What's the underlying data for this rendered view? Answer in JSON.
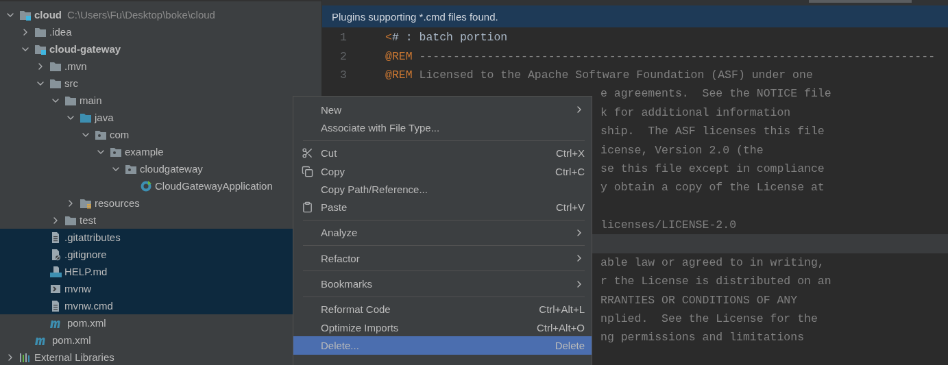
{
  "project_tree": {
    "items": [
      {
        "kind": "module",
        "name": "cloud",
        "path": "C:\\Users\\Fu\\Desktop\\boke\\cloud",
        "expanded": true,
        "selected": false,
        "children": [
          {
            "kind": "folder",
            "name": ".idea",
            "expanded": false,
            "selected": false
          },
          {
            "kind": "module",
            "name": "cloud-gateway",
            "expanded": true,
            "selected": false,
            "children": [
              {
                "kind": "folder",
                "name": ".mvn",
                "expanded": false,
                "selected": false
              },
              {
                "kind": "folder",
                "name": "src",
                "expanded": true,
                "selected": false,
                "children": [
                  {
                    "kind": "folder",
                    "name": "main",
                    "expanded": true,
                    "selected": false,
                    "children": [
                      {
                        "kind": "source",
                        "name": "java",
                        "expanded": true,
                        "selected": false,
                        "children": [
                          {
                            "kind": "package",
                            "name": "com",
                            "expanded": true,
                            "selected": false,
                            "children": [
                              {
                                "kind": "package",
                                "name": "example",
                                "expanded": true,
                                "selected": false,
                                "children": [
                                  {
                                    "kind": "package",
                                    "name": "cloudgateway",
                                    "expanded": true,
                                    "selected": false,
                                    "children": [
                                      {
                                        "kind": "class",
                                        "name": "CloudGatewayApplication",
                                        "selected": false
                                      }
                                    ]
                                  }
                                ]
                              }
                            ]
                          }
                        ]
                      },
                      {
                        "kind": "resources",
                        "name": "resources",
                        "expanded": false,
                        "selected": false
                      }
                    ]
                  },
                  {
                    "kind": "folder",
                    "name": "test",
                    "expanded": false,
                    "selected": false
                  }
                ]
              },
              {
                "kind": "text",
                "name": ".gitattributes",
                "selected": true
              },
              {
                "kind": "ignore",
                "name": ".gitignore",
                "selected": true
              },
              {
                "kind": "markdown",
                "name": "HELP.md",
                "selected": true
              },
              {
                "kind": "shell",
                "name": "mvnw",
                "selected": true
              },
              {
                "kind": "text",
                "name": "mvnw.cmd",
                "selected": true
              },
              {
                "kind": "maven",
                "name": "pom.xml",
                "selected": false
              }
            ]
          },
          {
            "kind": "maven",
            "name": "pom.xml",
            "selected": false
          }
        ]
      },
      {
        "kind": "libraries",
        "name": "External Libraries",
        "expanded": false,
        "selected": false
      }
    ]
  },
  "editor": {
    "notification": "Plugins supporting *.cmd files found.",
    "lines": [
      {
        "kind": "full",
        "number": "1",
        "keyword": "<",
        "text": "# : batch portion",
        "current": false
      },
      {
        "kind": "full",
        "number": "2",
        "keyword": "@REM",
        "text": "----------------------------------------------------------------------------",
        "current": false
      },
      {
        "kind": "full",
        "number": "3",
        "keyword": "@REM",
        "text": "Licensed to the Apache Software Foundation (ASF) under one",
        "current": false
      },
      {
        "kind": "partial",
        "text": "e agreements.  See the NOTICE file",
        "current": false
      },
      {
        "kind": "partial",
        "text": "k for additional information",
        "current": false
      },
      {
        "kind": "partial",
        "text": "ship.  The ASF licenses this file",
        "current": false
      },
      {
        "kind": "partial",
        "text": "icense, Version 2.0 (the",
        "current": false
      },
      {
        "kind": "partial",
        "text": "se this file except in compliance",
        "current": false
      },
      {
        "kind": "partial",
        "text": "y obtain a copy of the License at",
        "current": false
      },
      {
        "kind": "partial",
        "current": false
      },
      {
        "kind": "partial",
        "text": "licenses/LICENSE-2.0",
        "current": false
      },
      {
        "kind": "partial",
        "current": true
      },
      {
        "kind": "partial",
        "text": "able law or agreed to in writing,",
        "current": false
      },
      {
        "kind": "partial",
        "text": "r the License is distributed on an",
        "current": false
      },
      {
        "kind": "partial",
        "text": "RRANTIES OR CONDITIONS OF ANY",
        "current": false
      },
      {
        "kind": "partial",
        "text": "nplied.  See the License for the",
        "current": false
      },
      {
        "kind": "partial",
        "text": "ng permissions and limitations",
        "current": false
      }
    ]
  },
  "context_menu": {
    "items": [
      {
        "kind": "item",
        "label": "New",
        "submenu": true,
        "selected": false
      },
      {
        "kind": "item",
        "label": "Associate with File Type...",
        "submenu": false,
        "selected": false
      },
      {
        "kind": "separator"
      },
      {
        "kind": "item",
        "label": "Cut",
        "shortcut": "Ctrl+X",
        "submenu": false,
        "selected": false
      },
      {
        "kind": "item",
        "label": "Copy",
        "shortcut": "Ctrl+C",
        "submenu": false,
        "selected": false
      },
      {
        "kind": "item",
        "label": "Copy Path/Reference...",
        "submenu": false,
        "selected": false
      },
      {
        "kind": "item",
        "label": "Paste",
        "shortcut": "Ctrl+V",
        "submenu": false,
        "selected": false
      },
      {
        "kind": "separator"
      },
      {
        "kind": "item",
        "label": "Analyze",
        "submenu": true,
        "selected": false
      },
      {
        "kind": "separator"
      },
      {
        "kind": "item",
        "label": "Refactor",
        "submenu": true,
        "selected": false
      },
      {
        "kind": "separator"
      },
      {
        "kind": "item",
        "label": "Bookmarks",
        "submenu": true,
        "selected": false
      },
      {
        "kind": "separator"
      },
      {
        "kind": "item",
        "label": "Reformat Code",
        "shortcut": "Ctrl+Alt+L",
        "submenu": false,
        "selected": false
      },
      {
        "kind": "item",
        "label": "Optimize Imports",
        "shortcut": "Ctrl+Alt+O",
        "submenu": false,
        "selected": false
      },
      {
        "kind": "item",
        "label": "Delete...",
        "shortcut": "Delete",
        "submenu": false,
        "selected": true
      }
    ]
  }
}
